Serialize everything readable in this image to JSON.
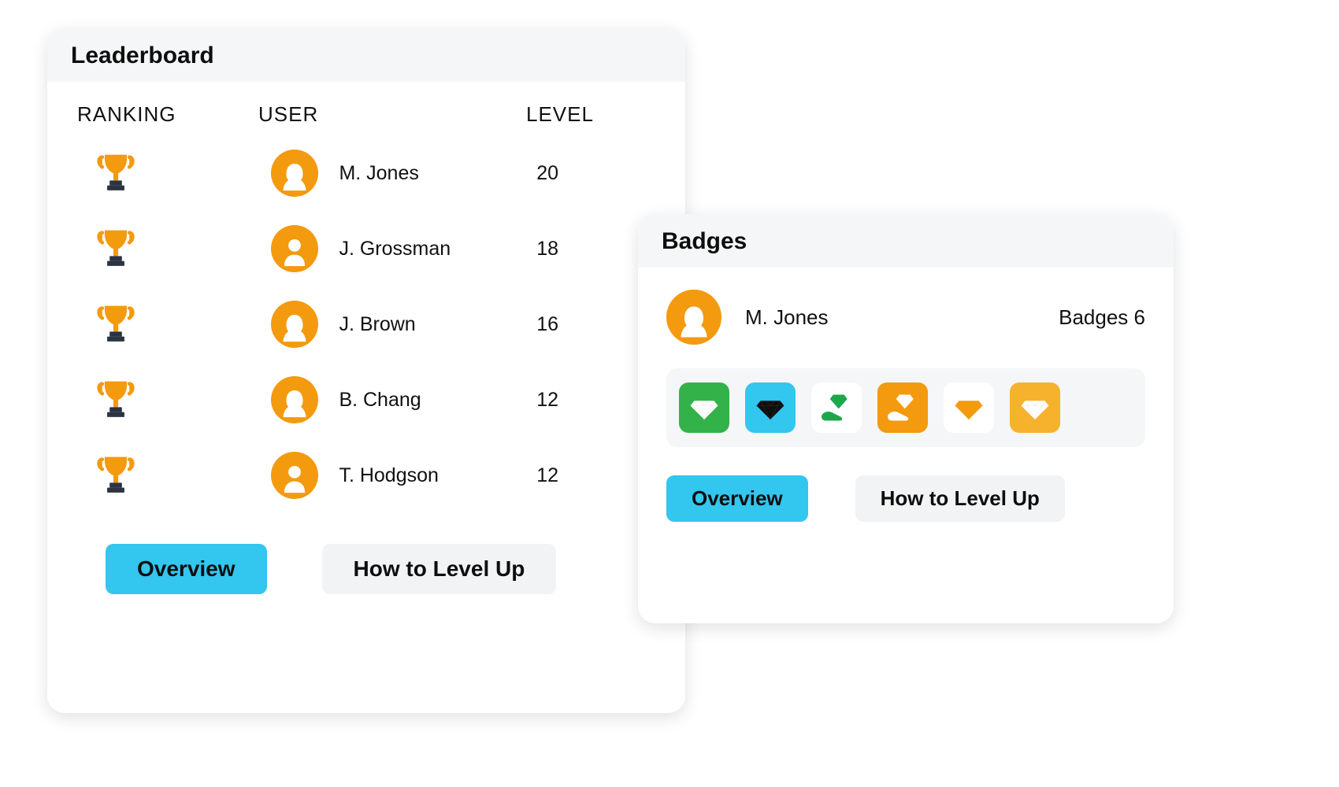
{
  "leaderboard": {
    "title": "Leaderboard",
    "columns": {
      "rank": "RANKING",
      "user": "USER",
      "level": "LEVEL"
    },
    "rows": [
      {
        "avatar": "female",
        "name": "M. Jones",
        "level": "20"
      },
      {
        "avatar": "male",
        "name": "J. Grossman",
        "level": "18"
      },
      {
        "avatar": "female",
        "name": "J. Brown",
        "level": "16"
      },
      {
        "avatar": "female",
        "name": "B. Chang",
        "level": "12"
      },
      {
        "avatar": "male",
        "name": "T. Hodgson",
        "level": "12"
      }
    ],
    "actions": {
      "overview": "Overview",
      "levelup": "How to Level Up"
    }
  },
  "badges": {
    "title": "Badges",
    "user": {
      "avatar": "female",
      "name": "M. Jones"
    },
    "count_label": "Badges 6",
    "items": [
      {
        "tile": "green",
        "glyph": "diamond",
        "glyph_color": "#ffffff"
      },
      {
        "tile": "blue",
        "glyph": "diamond",
        "glyph_color": "#0e0e0e"
      },
      {
        "tile": "white",
        "glyph": "hand-diamond",
        "glyph_color": "#1aa84b"
      },
      {
        "tile": "orange",
        "glyph": "hand-diamond",
        "glyph_color": "#ffffff"
      },
      {
        "tile": "white",
        "glyph": "diamond",
        "glyph_color": "#f39a0f"
      },
      {
        "tile": "amber",
        "glyph": "diamond",
        "glyph_color": "#ffffff"
      }
    ],
    "actions": {
      "overview": "Overview",
      "levelup": "How to Level Up"
    }
  },
  "colors": {
    "accent_orange": "#f39a0f",
    "accent_cyan": "#33c6ee",
    "panel_grey": "#f4f6f7"
  }
}
